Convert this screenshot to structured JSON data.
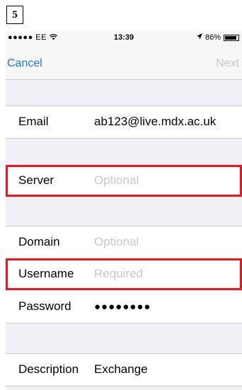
{
  "step_number": "5",
  "status_bar": {
    "carrier": "●●●●● EE",
    "time": "13:39",
    "battery": "86%"
  },
  "nav": {
    "cancel": "Cancel",
    "next": "Next"
  },
  "fields": {
    "email": {
      "label": "Email",
      "value": "ab123@live.mdx.ac.uk"
    },
    "server": {
      "label": "Server",
      "placeholder": "Optional"
    },
    "domain": {
      "label": "Domain",
      "placeholder": "Optional"
    },
    "username": {
      "label": "Username",
      "placeholder": "Required"
    },
    "password": {
      "label": "Password",
      "value": "●●●●●●●●"
    },
    "description": {
      "label": "Description",
      "value": "Exchange"
    }
  },
  "colors": {
    "accent": "#1a7ae0",
    "highlight": "#e8161d",
    "placeholder": "#c7c7cd",
    "group_background": "#efeff4"
  }
}
